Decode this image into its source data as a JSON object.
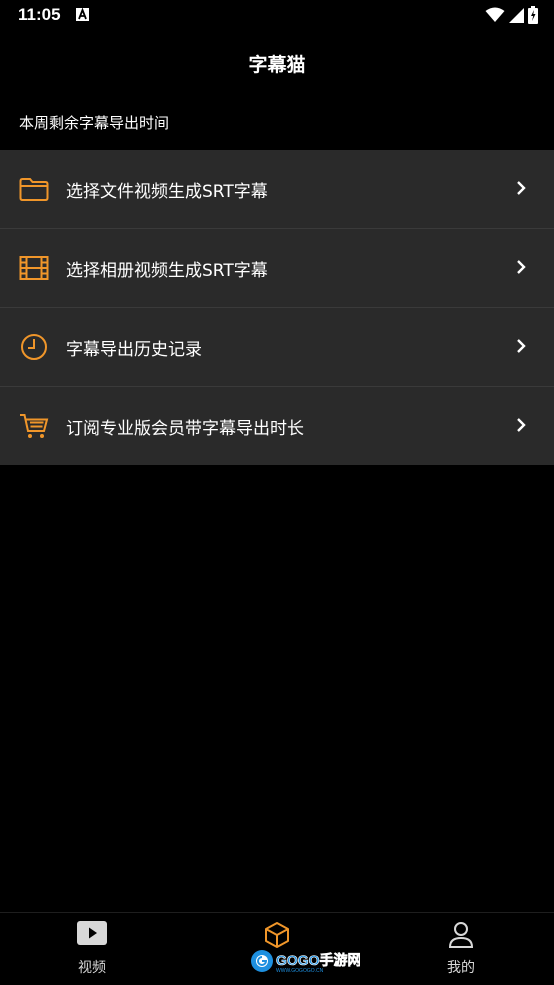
{
  "status_bar": {
    "time": "11:05"
  },
  "header": {
    "title": "字幕猫"
  },
  "info": {
    "remaining_label": "本周剩余字幕导出时间"
  },
  "menu": {
    "items": [
      {
        "label": "选择文件视频生成SRT字幕",
        "icon": "folder-icon"
      },
      {
        "label": "选择相册视频生成SRT字幕",
        "icon": "film-icon"
      },
      {
        "label": "字幕导出历史记录",
        "icon": "clock-icon"
      },
      {
        "label": "订阅专业版会员带字幕导出时长",
        "icon": "cart-icon"
      }
    ]
  },
  "bottom_nav": {
    "items": [
      {
        "label": "视频",
        "icon": "video-icon"
      },
      {
        "label": "",
        "icon": "cube-icon",
        "active": true
      },
      {
        "label": "我的",
        "icon": "person-icon"
      }
    ]
  },
  "watermark": {
    "text": "GOGO手游网",
    "subtext": "WWW.GOGOGO.CN"
  },
  "colors": {
    "accent": "#f0962a",
    "background": "#000000",
    "card": "#2a2a2a"
  }
}
